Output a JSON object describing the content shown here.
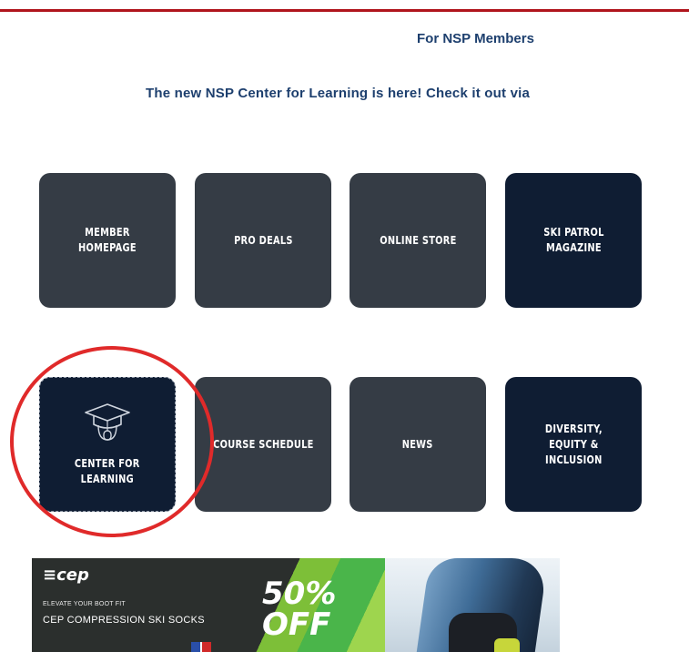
{
  "header": {
    "section_title": "For NSP Members",
    "announcement": "The new NSP Center for Learning is here!  Check it out via"
  },
  "tiles": [
    {
      "label": "Member\nHomepage"
    },
    {
      "label": "Pro Deals"
    },
    {
      "label": "Online Store"
    },
    {
      "label": "Ski Patrol\nMagazine"
    },
    {
      "label": "Center for\nLearning",
      "icon": "graduation-cap-icon"
    },
    {
      "label": "Course Schedule"
    },
    {
      "label": "News"
    },
    {
      "label": "Diversity,\nEquity &\nInclusion"
    }
  ],
  "ad": {
    "logo": "≡cep",
    "kicker": "Elevate your boot fit",
    "headline": "CEP Compression Ski Socks",
    "discount_line1": "50%",
    "discount_line2": "OFF"
  },
  "colors": {
    "accent_rule": "#b0151c",
    "heading_text": "#1d3f6e",
    "tile_slate": "#353c45",
    "tile_navy": "#0f1d33",
    "highlight_ring": "#e02a2a"
  }
}
